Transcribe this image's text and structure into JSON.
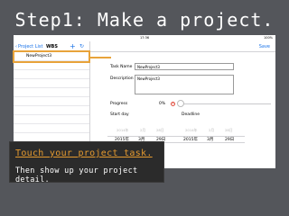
{
  "slide": {
    "title": "Step1: Make a project.",
    "caption_line1": "Touch your project task.",
    "caption_line2": "Then show up your project detail."
  },
  "colors": {
    "slide_background": "#54565b",
    "accent_orange": "#e8a33a",
    "ios_blue": "#1a73e8"
  },
  "app": {
    "status_bar": {
      "time": "17:36",
      "battery": "100%"
    },
    "master": {
      "back_label": "Project List",
      "title": "WBS",
      "add_icon": "plus-icon",
      "refresh_icon": "refresh-icon",
      "items": [
        "NewProject3"
      ]
    },
    "detail": {
      "save_label": "Save",
      "task_name_label": "Task Name",
      "task_name_value": "NewProject3",
      "description_label": "Description",
      "description_value": "NewProject3",
      "progress_label": "Progress",
      "progress_value": "0%",
      "start_day_label": "Start day",
      "deadline_label": "Deadline",
      "start_picker": {
        "faded_year": "2014年",
        "faded_month": "2月",
        "faded_day": "28日",
        "year": "2015年",
        "month": "3月",
        "day": "29日"
      },
      "deadline_picker": {
        "faded_year": "2014年",
        "faded_month": "2月",
        "faded_day": "28日",
        "year": "2015年",
        "month": "3月",
        "day": "29日"
      }
    }
  }
}
